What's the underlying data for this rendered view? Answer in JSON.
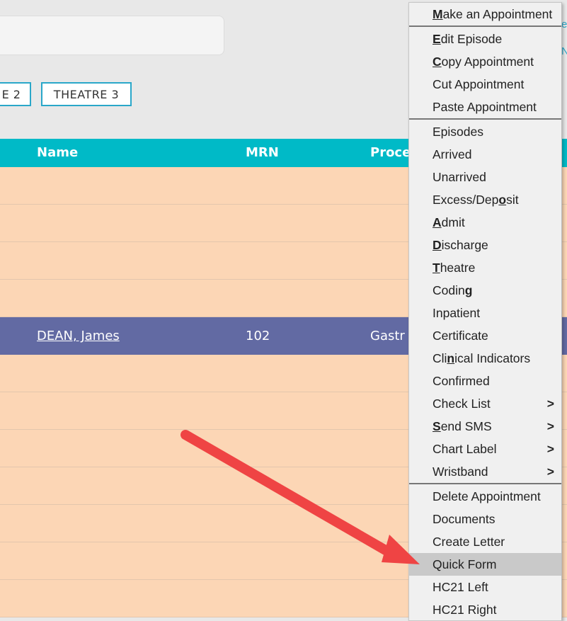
{
  "theatre_tabs": [
    "E 2",
    "THEATRE 3"
  ],
  "table": {
    "headers": {
      "name": "Name",
      "mrn": "MRN",
      "procedure": "Proce"
    },
    "rows": [
      {
        "name": "",
        "mrn": "",
        "procedure": ""
      },
      {
        "name": "",
        "mrn": "",
        "procedure": ""
      },
      {
        "name": "",
        "mrn": "",
        "procedure": ""
      },
      {
        "name": "",
        "mrn": "",
        "procedure": ""
      },
      {
        "name": "DEAN, James",
        "mrn": "102",
        "procedure": "Gastr",
        "selected": true
      },
      {
        "name": "",
        "mrn": "",
        "procedure": ""
      },
      {
        "name": "",
        "mrn": "",
        "procedure": ""
      },
      {
        "name": "",
        "mrn": "",
        "procedure": ""
      },
      {
        "name": "",
        "mrn": "",
        "procedure": ""
      },
      {
        "name": "",
        "mrn": "",
        "procedure": ""
      },
      {
        "name": "",
        "mrn": "",
        "procedure": ""
      },
      {
        "name": "",
        "mrn": "",
        "procedure": ""
      }
    ]
  },
  "edge_text": [
    "e",
    "N"
  ],
  "context_menu": {
    "groups": [
      [
        {
          "label": "Make an Appointment",
          "access_key_index": 0
        }
      ],
      [
        {
          "label": "Edit Episode",
          "access_key_index": 0
        },
        {
          "label": "Copy Appointment",
          "access_key_index": 0
        },
        {
          "label": "Cut Appointment"
        },
        {
          "label": "Paste Appointment"
        }
      ],
      [
        {
          "label": "Episodes"
        },
        {
          "label": "Arrived"
        },
        {
          "label": "Unarrived"
        },
        {
          "label": "Excess/Deposit",
          "access_key_index": 10
        },
        {
          "label": "Admit",
          "access_key_index": 0
        },
        {
          "label": "Discharge",
          "access_key_index": 0
        },
        {
          "label": "Theatre",
          "access_key_index": 0
        },
        {
          "label": "Coding",
          "access_key_index": 5
        },
        {
          "label": "Inpatient"
        },
        {
          "label": "Certificate"
        },
        {
          "label": "Clinical Indicators",
          "access_key_index": 3
        },
        {
          "label": "Confirmed"
        },
        {
          "label": "Check List",
          "submenu_indicator": ">"
        },
        {
          "label": "Send SMS",
          "access_key_index": 0,
          "submenu_indicator": ">"
        },
        {
          "label": "Chart Label",
          "submenu_indicator": ">"
        },
        {
          "label": "Wristband",
          "submenu_indicator": ">"
        }
      ],
      [
        {
          "label": "Delete Appointment"
        },
        {
          "label": "Documents"
        },
        {
          "label": "Create Letter"
        },
        {
          "label": "Quick Form",
          "highlighted": true
        },
        {
          "label": "HC21 Left"
        },
        {
          "label": "HC21 Right"
        }
      ]
    ]
  },
  "annotation": {
    "color": "#ef4444",
    "points_to": "Quick Form"
  }
}
